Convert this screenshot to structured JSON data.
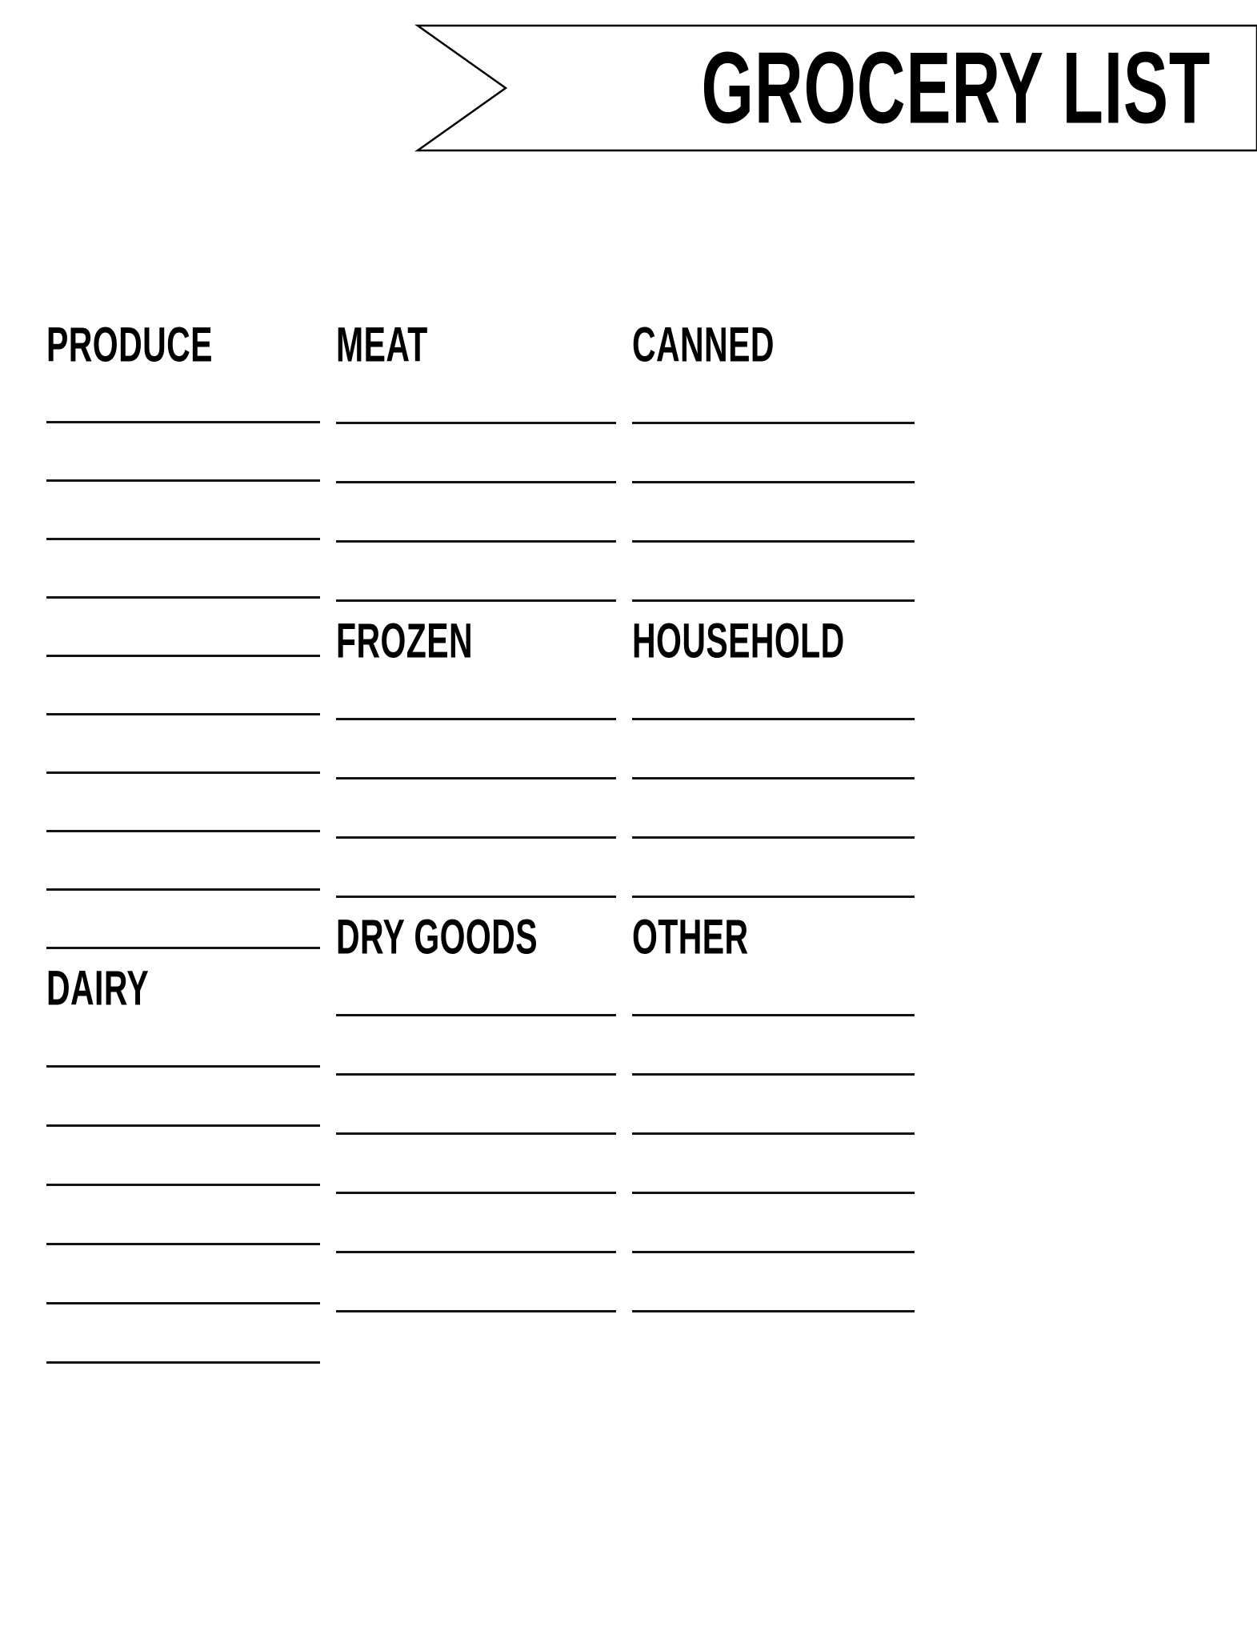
{
  "document": {
    "title": "GROCERY LIST",
    "type": "printable-grocery-list",
    "background_color": "#ffffff",
    "ink_color": "#000000",
    "rule_color": "#141414"
  },
  "banner": {
    "label": "GROCERY LIST",
    "shape": "ribbon-with-left-chevron-notch",
    "stroke_color": "#000000",
    "fill_color": "#ffffff"
  },
  "columns": [
    {
      "name": "column-1",
      "sections": [
        {
          "heading": "PRODUCE",
          "lines": 10
        },
        {
          "heading": "DAIRY",
          "lines": 6
        }
      ]
    },
    {
      "name": "column-2",
      "sections": [
        {
          "heading": "MEAT",
          "lines": 4
        },
        {
          "heading": "FROZEN",
          "lines": 4
        },
        {
          "heading": "DRY GOODS",
          "lines": 6
        }
      ]
    },
    {
      "name": "column-3",
      "sections": [
        {
          "heading": "CANNED",
          "lines": 4
        },
        {
          "heading": "HOUSEHOLD",
          "lines": 4
        },
        {
          "heading": "OTHER",
          "lines": 6
        }
      ]
    }
  ]
}
